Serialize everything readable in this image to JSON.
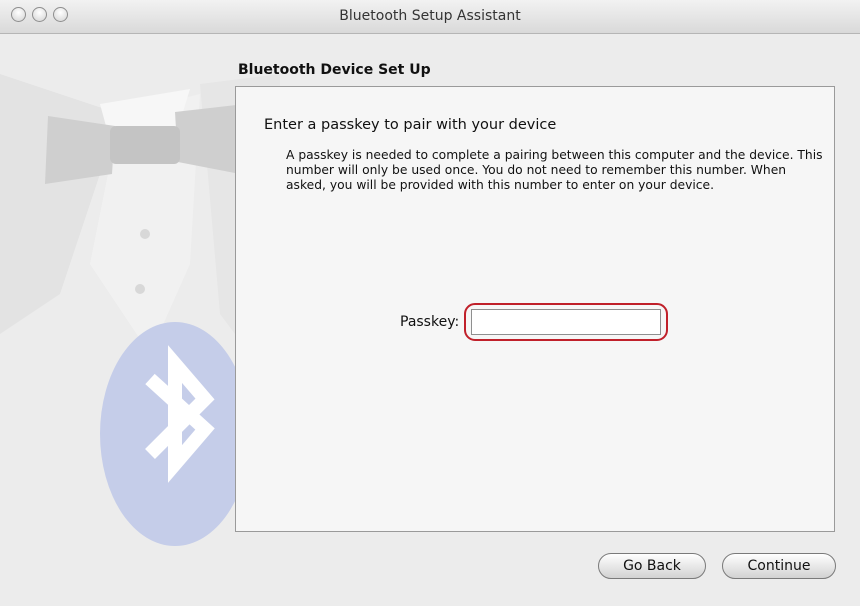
{
  "window": {
    "title": "Bluetooth Setup Assistant"
  },
  "section": {
    "heading": "Bluetooth Device Set Up"
  },
  "panel": {
    "heading": "Enter a passkey to pair with your device",
    "description": "A passkey is needed to complete a pairing between this computer and the device. This number will only be used once. You do not need to remember this number. When asked, you will be provided with this number to enter on your device.",
    "passkey_label": "Passkey:",
    "passkey_value": ""
  },
  "buttons": {
    "back": "Go Back",
    "continue": "Continue"
  },
  "colors": {
    "highlight": "#c0202a",
    "bluetooth_badge": "#c5cde9"
  },
  "icons": {
    "sidebar_art": "tuxedo-with-bluetooth-badge",
    "traffic_lights": [
      "close-icon",
      "minimize-icon",
      "zoom-icon"
    ]
  }
}
